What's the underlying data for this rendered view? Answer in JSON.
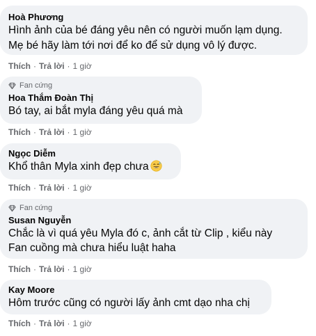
{
  "comments": [
    {
      "author": "Hoà Phương",
      "badge": "",
      "text": "Hình ảnh của bé đáng yêu nên có người muốn lạm dụng.\nMẹ bé hãy làm tới nơi để ko để sử dụng vô lý được.",
      "like_label": "Thích",
      "reply_label": "Trả lời",
      "time": "1 giờ"
    },
    {
      "author": "Hoa Thắm Đoàn Thị",
      "badge": "Fan cứng",
      "text": "Bó tay, ai bắt myla đáng yêu quá mà",
      "like_label": "Thích",
      "reply_label": "Trả lời",
      "time": "1 giờ"
    },
    {
      "author": "Ngọc Diễm",
      "badge": "",
      "text": "Khổ thân Myla xinh đẹp chưa",
      "emoji": "grinning-sweat-emoji",
      "like_label": "Thích",
      "reply_label": "Trả lời",
      "time": "1 giờ"
    },
    {
      "author": "Susan Nguyễn",
      "badge": "Fan cứng",
      "text": "Chắc là vì quá yêu Myla đó c, ảnh cắt từ Clip , kiểu này\nFan cuồng mà chưa hiểu luật haha",
      "like_label": "Thích",
      "reply_label": "Trả lời",
      "time": "1 giờ"
    },
    {
      "author": "Kay Moore",
      "badge": "",
      "text": "Hôm trước cũng có người lấy ảnh cmt dạo nha chị",
      "like_label": "Thích",
      "reply_label": "Trả lời",
      "time": "1 giờ"
    }
  ],
  "separator": "·",
  "colors": {
    "bubble": "#f0f2f5",
    "secondary_text": "#65676b",
    "primary_text": "#050505"
  }
}
